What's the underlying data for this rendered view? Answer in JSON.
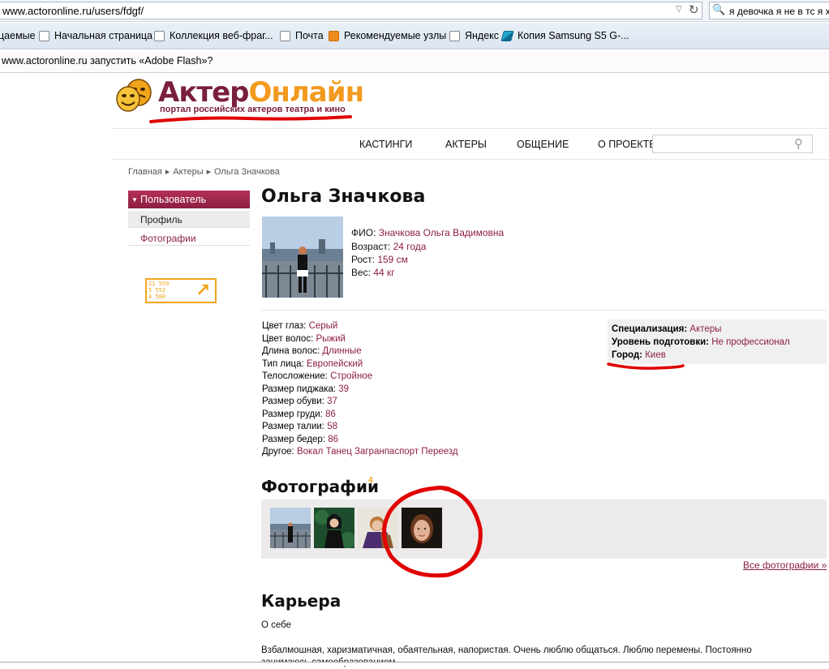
{
  "browser": {
    "url": "www.actoronline.ru/users/fdgf/",
    "search_query": "я девочка я не в тс я хо",
    "bookmarks": [
      {
        "label": "цаемые",
        "icon": "none"
      },
      {
        "label": "Начальная страница",
        "icon": "page-icon"
      },
      {
        "label": "Коллекция веб-фраг...",
        "icon": "page-icon"
      },
      {
        "label": "Почта",
        "icon": "page-icon"
      },
      {
        "label": "Рекомендуемые узлы",
        "icon": "orange-ie-icon"
      },
      {
        "label": "Яндекс",
        "icon": "page-icon"
      },
      {
        "label": "Копия Samsung S5 G-...",
        "icon": "bookmark-flag-icon"
      }
    ],
    "notification": "www.actoronline.ru запустить «Adobe Flash»?"
  },
  "site": {
    "logo_part1": "Актер",
    "logo_part2": "Онлайн",
    "tagline": "портал российских актеров театра и кино",
    "nav": [
      "КАСТИНГИ",
      "АКТЕРЫ",
      "ОБЩЕНИЕ",
      "О ПРОЕКТЕ"
    ],
    "breadcrumb": [
      "Главная",
      "Актеры",
      "Ольга Значкова"
    ],
    "colors": {
      "brand": "#7a1f3c",
      "accent": "#f29a1f",
      "link": "#8c1f41"
    }
  },
  "sidebar": {
    "header": "Пользователь",
    "items": [
      "Профиль",
      "Фотографии"
    ],
    "counter": [
      "21 559",
      "5 552",
      "4 580"
    ]
  },
  "profile": {
    "name": "Ольга Значкова",
    "fio_label": "ФИО:",
    "fio": "Значкова Ольга Вадимовна",
    "age_label": "Возраст:",
    "age": "24 года",
    "height_label": "Рост:",
    "height": "159 см",
    "weight_label": "Вес:",
    "weight": "44 кг",
    "attributes": [
      {
        "label": "Цвет глаз:",
        "value": "Серый"
      },
      {
        "label": "Цвет волос:",
        "value": "Рыжий"
      },
      {
        "label": "Длина волос:",
        "value": "Длинные"
      },
      {
        "label": "Тип лица:",
        "value": "Европейский"
      },
      {
        "label": "Телосложение:",
        "value": "Стройное"
      },
      {
        "label": "Размер пиджака:",
        "value": "39"
      },
      {
        "label": "Размер обуви:",
        "value": "37"
      },
      {
        "label": "Размер груди:",
        "value": "86"
      },
      {
        "label": "Размер талии:",
        "value": "58"
      },
      {
        "label": "Размер бедер:",
        "value": "86"
      },
      {
        "label": "Другое:",
        "value": "Вокал Танец Загранпаспорт Переезд"
      }
    ],
    "spec_label": "Специализация:",
    "spec": "Актеры",
    "level_label": "Уровень подготовки:",
    "level": "Не профессионал",
    "city_label": "Город:",
    "city": "Киев"
  },
  "photos": {
    "title": "Фотографии",
    "count": "4",
    "all_link": "Все фотографии »"
  },
  "career": {
    "title": "Карьера",
    "about_label": "О себе",
    "about_text": "Взбалмошная, харизматичная, обаятельная, напористая. Очень люблю общаться. Люблю перемены. Постоянно занимаюсь самообразованием."
  }
}
